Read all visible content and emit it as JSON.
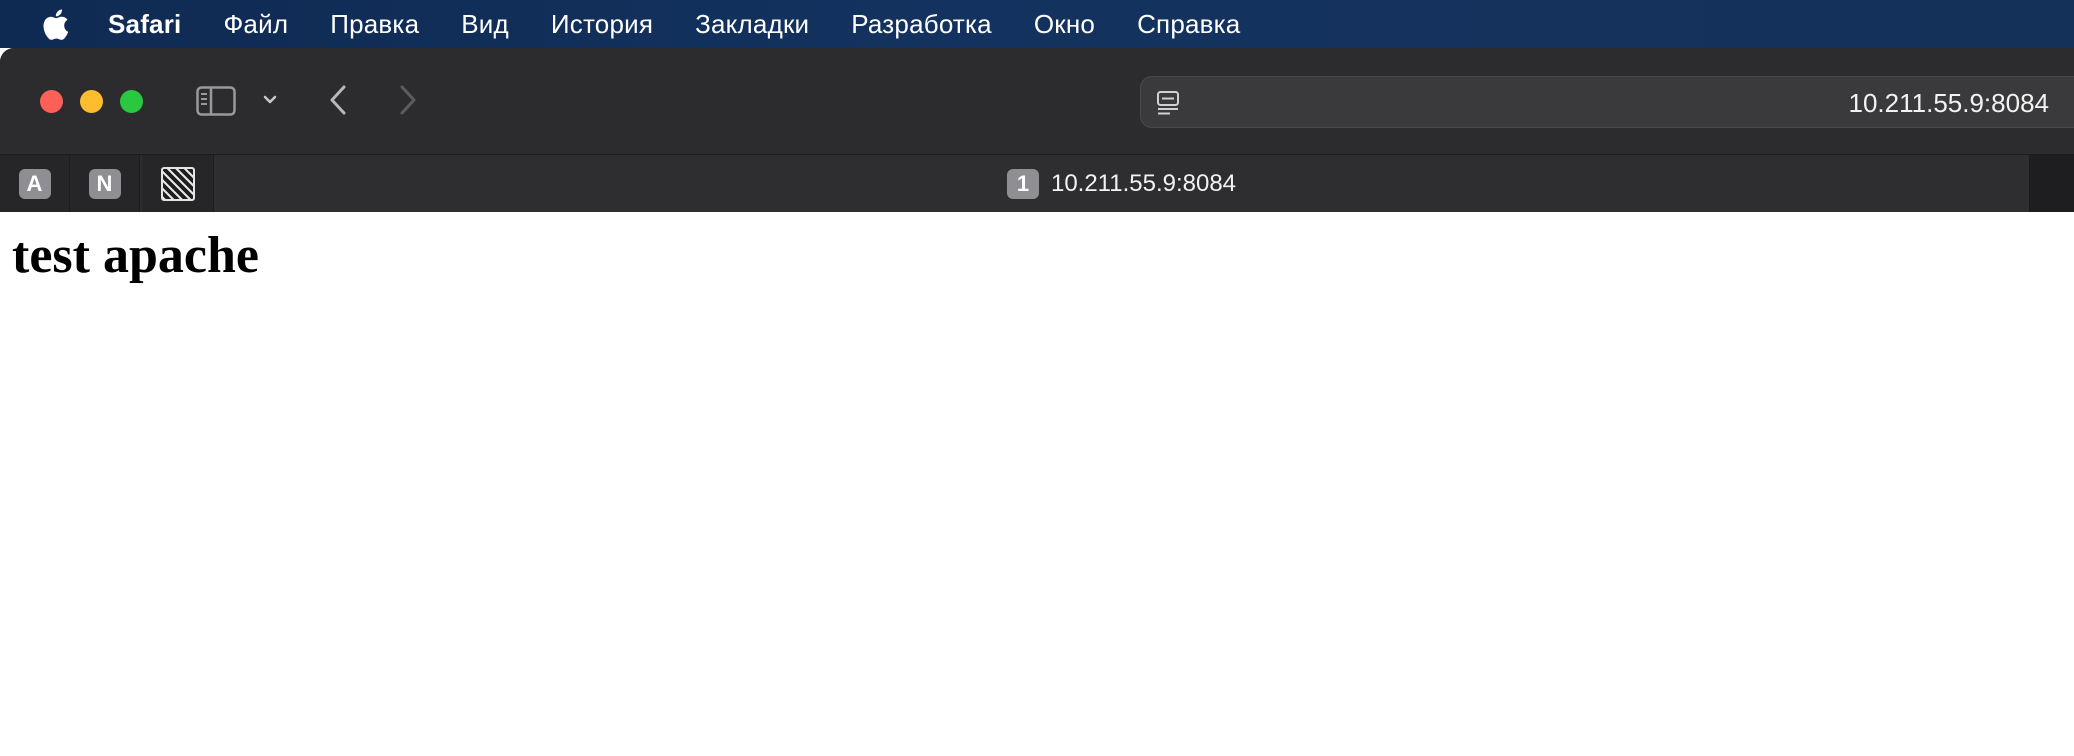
{
  "menubar": {
    "app_name": "Safari",
    "items": [
      "Файл",
      "Правка",
      "Вид",
      "История",
      "Закладки",
      "Разработка",
      "Окно",
      "Справка"
    ]
  },
  "toolbar": {
    "address": "10.211.55.9:8084"
  },
  "tabs": {
    "pinned": [
      {
        "label": "A"
      },
      {
        "label": "N"
      },
      {
        "icon": "hatched-square-icon"
      }
    ],
    "active": {
      "count": "1",
      "title": "10.211.55.9:8084"
    }
  },
  "page": {
    "heading": "test apache"
  },
  "colors": {
    "menubar_bg": "#13325f",
    "toolbar_bg": "#2c2c2e",
    "close": "#fe5f57",
    "minimize": "#febc2e",
    "maximize": "#28c840"
  }
}
